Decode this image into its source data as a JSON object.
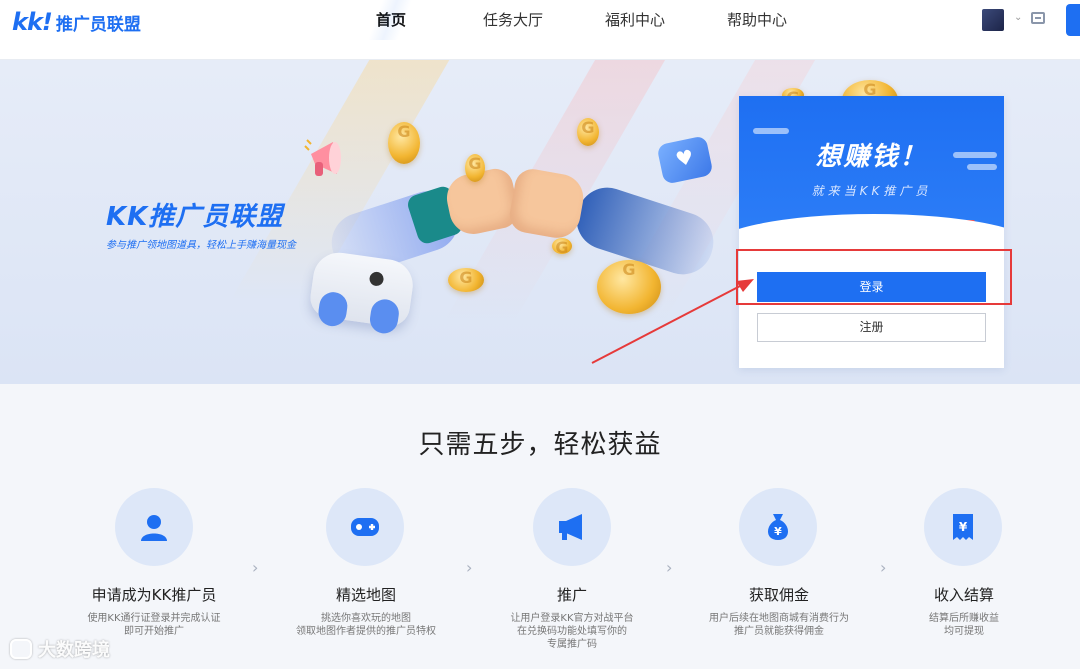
{
  "header": {
    "logo_mark": "kk!",
    "logo_text": "推广员联盟",
    "nav": [
      {
        "label": "首页",
        "active": true
      },
      {
        "label": "任务大厅",
        "active": false
      },
      {
        "label": "福利中心",
        "active": false
      },
      {
        "label": "帮助中心",
        "active": false
      }
    ],
    "accent_color": "#1e6ff2"
  },
  "banner": {
    "title": "KK推广员联盟",
    "subtitle": "参与推广领地图道具，轻松上手赚海量现金"
  },
  "login_card": {
    "title": "想赚钱！",
    "subtitle": "就来当KK推广员",
    "login_label": "登录",
    "register_label": "注册"
  },
  "annotation": {
    "color": "#e63a3a"
  },
  "steps_section": {
    "title": "只需五步，轻松获益",
    "steps": [
      {
        "icon": "user-icon",
        "title": "申请成为KK推广员",
        "desc": [
          "使用KK通行证登录并完成认证",
          "即可开始推广"
        ]
      },
      {
        "icon": "gamepad-icon",
        "title": "精选地图",
        "desc": [
          "挑选你喜欢玩的地图",
          "领取地图作者提供的推广员特权"
        ]
      },
      {
        "icon": "megaphone-icon",
        "title": "推广",
        "desc": [
          "让用户登录KK官方对战平台",
          "在兑换码功能处填写你的",
          "专属推广码"
        ]
      },
      {
        "icon": "money-bag-icon",
        "title": "获取佣金",
        "desc": [
          "用户后续在地图商城有消费行为",
          "推广员就能获得佣金"
        ]
      },
      {
        "icon": "receipt-icon",
        "title": "收入结算",
        "desc": [
          "结算后所赚收益",
          "均可提现"
        ]
      }
    ]
  },
  "watermark": {
    "text": "大数跨境"
  }
}
